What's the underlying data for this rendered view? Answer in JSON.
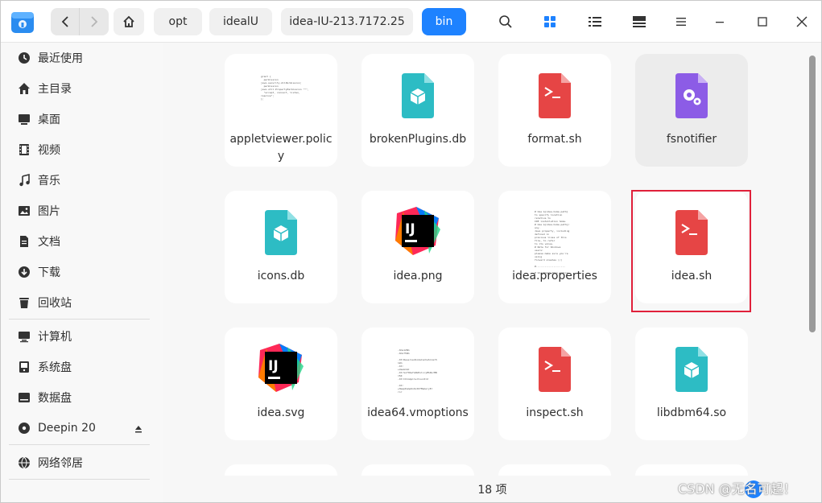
{
  "toolbar": {
    "crumbs": [
      "opt",
      "idealU",
      "idea-IU-213.7172.25",
      "bin"
    ]
  },
  "sidebar": {
    "items": [
      {
        "label": "最近使用",
        "icon": "clock-icon"
      },
      {
        "label": "主目录",
        "icon": "home-icon"
      },
      {
        "label": "桌面",
        "icon": "desktop-icon"
      },
      {
        "label": "视频",
        "icon": "video-icon"
      },
      {
        "label": "音乐",
        "icon": "music-icon"
      },
      {
        "label": "图片",
        "icon": "picture-icon"
      },
      {
        "label": "文档",
        "icon": "document-icon"
      },
      {
        "label": "下载",
        "icon": "download-icon"
      },
      {
        "label": "回收站",
        "icon": "trash-icon"
      },
      {
        "label": "计算机",
        "icon": "computer-icon"
      },
      {
        "label": "系统盘",
        "icon": "disk-icon"
      },
      {
        "label": "数据盘",
        "icon": "disk-icon"
      },
      {
        "label": "Deepin 20",
        "icon": "disc-icon"
      },
      {
        "label": "网络邻居",
        "icon": "network-icon"
      }
    ]
  },
  "files": [
    {
      "name": "appletviewer.policy",
      "type": "text"
    },
    {
      "name": "brokenPlugins.db",
      "type": "db"
    },
    {
      "name": "format.sh",
      "type": "shell"
    },
    {
      "name": "fsnotifier",
      "type": "executable"
    },
    {
      "name": "icons.db",
      "type": "db"
    },
    {
      "name": "idea.png",
      "type": "intellij"
    },
    {
      "name": "idea.properties",
      "type": "text"
    },
    {
      "name": "idea.sh",
      "type": "shell"
    },
    {
      "name": "idea.svg",
      "type": "intellij"
    },
    {
      "name": "idea64.vmoptions",
      "type": "text"
    },
    {
      "name": "inspect.sh",
      "type": "shell"
    },
    {
      "name": "libdbm64.so",
      "type": "db"
    }
  ],
  "status": {
    "count": "18 项"
  },
  "watermark": "CSDN @无名可起！",
  "colors": {
    "accent": "#1e82ff",
    "shell": "#e64545",
    "db": "#2dbcc4",
    "exec": "#8c5ce6",
    "highlight": "#e0203a"
  }
}
